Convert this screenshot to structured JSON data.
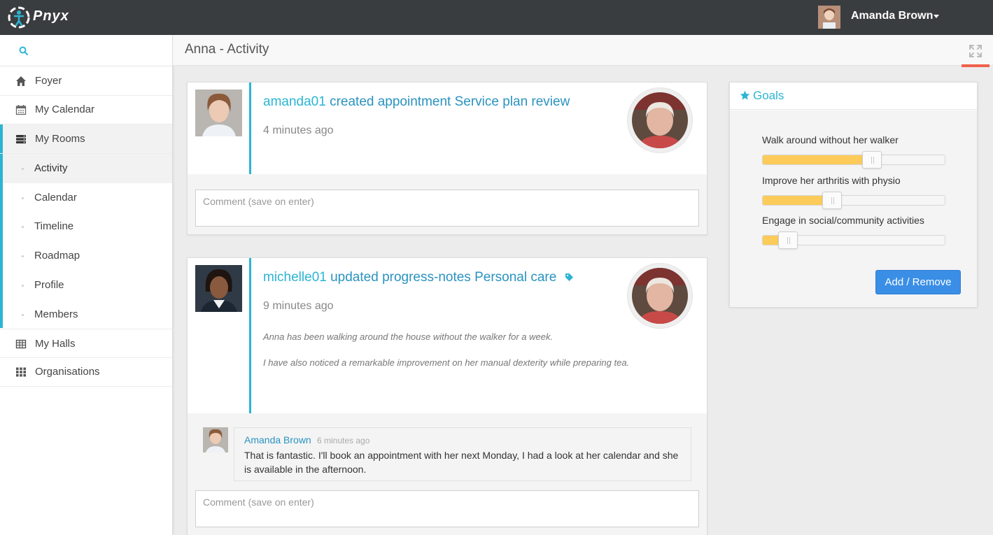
{
  "topbar": {
    "logo_text": "Pnyx",
    "user_name": "Amanda Brown"
  },
  "sidebar": {
    "items": [
      {
        "label": "Foyer",
        "icon": "home-icon"
      },
      {
        "label": "My Calendar",
        "icon": "calendar-icon"
      },
      {
        "label": "My Rooms",
        "icon": "rooms-icon"
      },
      {
        "label": "My Halls",
        "icon": "table-icon"
      },
      {
        "label": "Organisations",
        "icon": "grid-icon"
      }
    ],
    "rooms_sub": [
      "Activity",
      "Calendar",
      "Timeline",
      "Roadmap",
      "Profile",
      "Members"
    ]
  },
  "page": {
    "title": "Anna - Activity"
  },
  "activity": [
    {
      "user": "amanda01",
      "action": "created appointment Service plan review",
      "time": "4 minutes ago",
      "comment_placeholder": "Comment (save on enter)"
    },
    {
      "user": "michelle01",
      "action": "updated progress-notes Personal care",
      "time": "9 minutes ago",
      "notes": [
        "Anna has been walking around the house without the walker for a week.",
        "I have also noticed a remarkable improvement on her manual dexterity while preparing tea."
      ],
      "reply": {
        "name": "Amanda Brown",
        "time": "6 minutes ago",
        "text": "That is fantastic. I'll book an appointment with her next Monday, I had a look at her calendar and she is available in the afternoon."
      },
      "comment_placeholder": "Comment (save on enter)"
    }
  ],
  "goals": {
    "title": "Goals",
    "items": [
      {
        "label": "Walk around without her walker",
        "progress": 0.6
      },
      {
        "label": "Improve her arthritis with physio",
        "progress": 0.38
      },
      {
        "label": "Engage in social/community activities",
        "progress": 0.14
      }
    ],
    "button_label": "Add / Remove"
  },
  "colors": {
    "accent": "#2bb5d3",
    "link": "#2a93c0",
    "goal_fill": "#fdcb5a",
    "button": "#3a8ee6",
    "topbar": "#3a3d40",
    "expand_indicator": "#f0614a"
  }
}
